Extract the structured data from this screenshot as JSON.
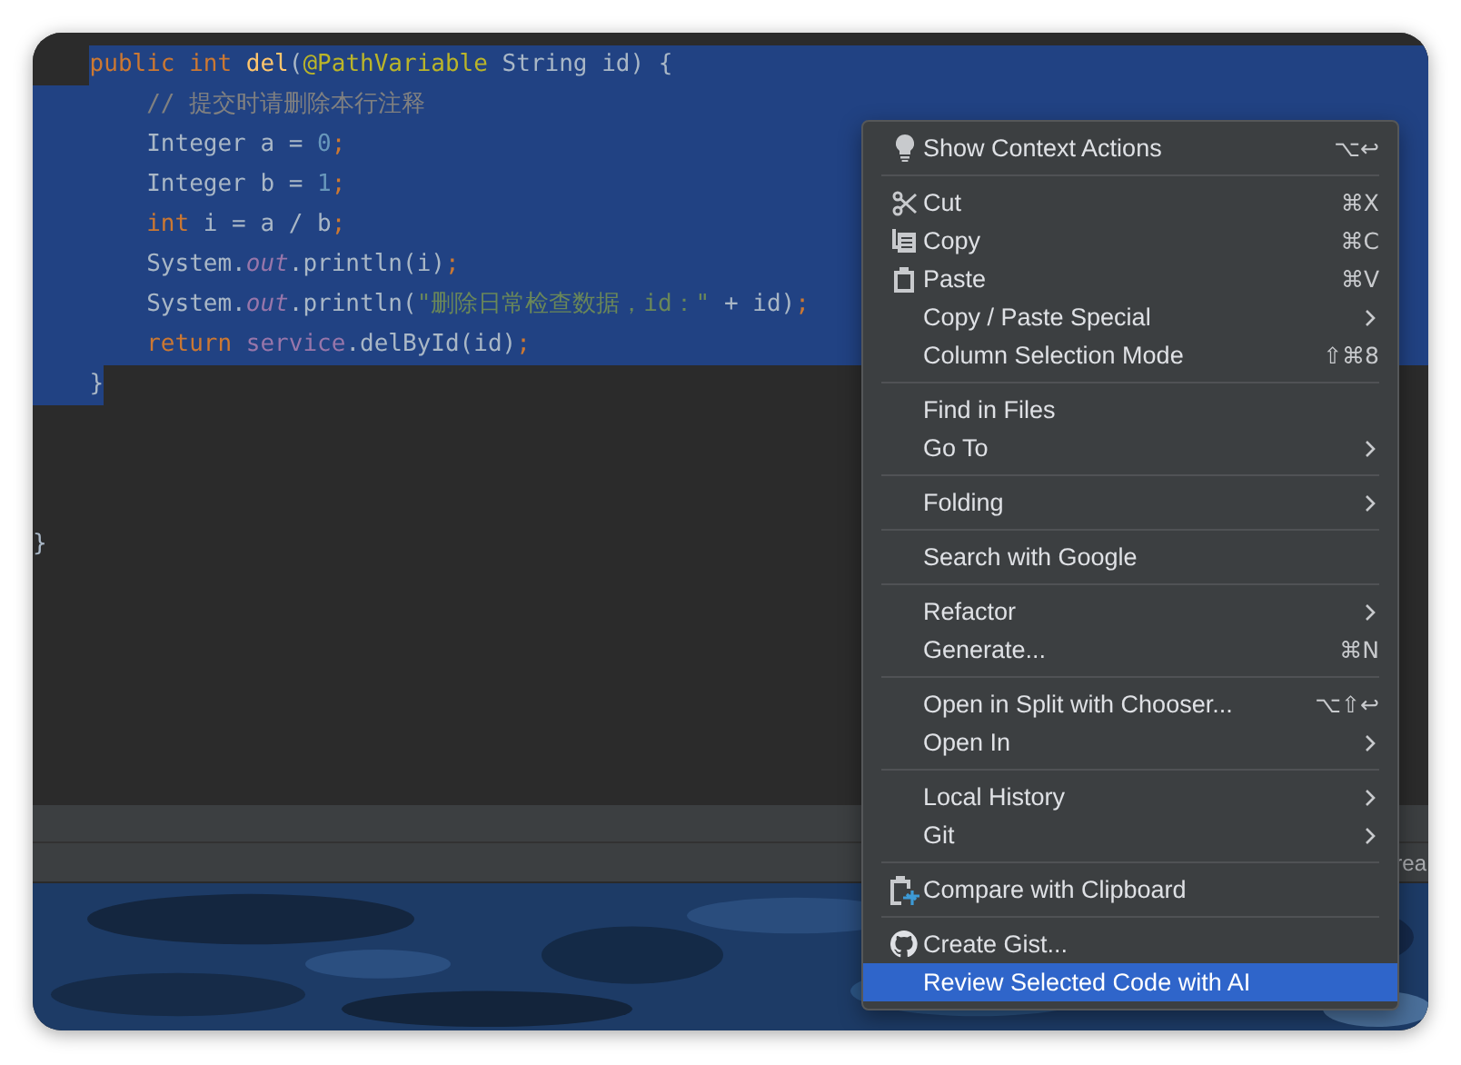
{
  "editor": {
    "code_lines": [
      {
        "kind": "signature",
        "selected": true,
        "tokens": [
          {
            "kind": "keyword",
            "text": "public "
          },
          {
            "kind": "keyword",
            "text": "int "
          },
          {
            "kind": "method",
            "text": "del"
          },
          {
            "kind": "plain",
            "text": "("
          },
          {
            "kind": "annotation",
            "text": "@PathVariable"
          },
          {
            "kind": "plain",
            "text": " String id) {"
          }
        ]
      },
      {
        "kind": "statement",
        "selected": true,
        "tokens": [
          {
            "kind": "comment",
            "text": "// 提交时请删除本行注释"
          }
        ]
      },
      {
        "kind": "statement",
        "selected": true,
        "tokens": [
          {
            "kind": "plain",
            "text": "Integer a = "
          },
          {
            "kind": "number",
            "text": "0"
          },
          {
            "kind": "punct",
            "text": ";"
          }
        ]
      },
      {
        "kind": "statement",
        "selected": true,
        "tokens": [
          {
            "kind": "plain",
            "text": "Integer b = "
          },
          {
            "kind": "number",
            "text": "1"
          },
          {
            "kind": "punct",
            "text": ";"
          }
        ]
      },
      {
        "kind": "statement",
        "selected": true,
        "tokens": [
          {
            "kind": "keyword",
            "text": "int"
          },
          {
            "kind": "plain",
            "text": " i = a / b"
          },
          {
            "kind": "punct",
            "text": ";"
          }
        ]
      },
      {
        "kind": "statement",
        "selected": true,
        "tokens": [
          {
            "kind": "plain",
            "text": "System."
          },
          {
            "kind": "static",
            "text": "out"
          },
          {
            "kind": "plain",
            "text": ".println(i)"
          },
          {
            "kind": "punct",
            "text": ";"
          }
        ]
      },
      {
        "kind": "statement",
        "selected": true,
        "tokens": [
          {
            "kind": "plain",
            "text": "System."
          },
          {
            "kind": "static",
            "text": "out"
          },
          {
            "kind": "plain",
            "text": ".println("
          },
          {
            "kind": "string",
            "text": "\"删除日常检查数据，id：\""
          },
          {
            "kind": "plain",
            "text": " + id)"
          },
          {
            "kind": "punct",
            "text": ";"
          }
        ]
      },
      {
        "kind": "statement",
        "selected": true,
        "tokens": [
          {
            "kind": "keyword",
            "text": "return "
          },
          {
            "kind": "field",
            "text": "service"
          },
          {
            "kind": "plain",
            "text": ".delById(id)"
          },
          {
            "kind": "punct",
            "text": ";"
          }
        ]
      },
      {
        "kind": "block-end",
        "selected": true,
        "tokens": [
          {
            "kind": "plain",
            "text": "}"
          }
        ]
      }
    ],
    "class_closing": "}"
  },
  "status_bar": {
    "text": "rea"
  },
  "context_menu": {
    "groups": [
      [
        {
          "kind": "bulb",
          "label": "Show Context Actions",
          "shortcut": "⌥↩",
          "submenu": false,
          "selected": false
        }
      ],
      [
        {
          "kind": "scissors",
          "label": "Cut",
          "shortcut": "⌘X",
          "submenu": false,
          "selected": false
        },
        {
          "kind": "copy",
          "label": "Copy",
          "shortcut": "⌘C",
          "submenu": false,
          "selected": false
        },
        {
          "kind": "clipboard",
          "label": "Paste",
          "shortcut": "⌘V",
          "submenu": false,
          "selected": false
        },
        {
          "kind": "plain",
          "label": "Copy / Paste Special",
          "submenu": true,
          "selected": false
        },
        {
          "kind": "plain",
          "label": "Column Selection Mode",
          "shortcut": "⇧⌘8",
          "submenu": false,
          "selected": false
        }
      ],
      [
        {
          "kind": "plain",
          "label": "Find in Files",
          "submenu": false,
          "selected": false
        },
        {
          "kind": "plain",
          "label": "Go To",
          "submenu": true,
          "selected": false
        }
      ],
      [
        {
          "kind": "plain",
          "label": "Folding",
          "submenu": true,
          "selected": false
        }
      ],
      [
        {
          "kind": "plain",
          "label": "Search with Google",
          "submenu": false,
          "selected": false
        }
      ],
      [
        {
          "kind": "plain",
          "label": "Refactor",
          "submenu": true,
          "selected": false
        },
        {
          "kind": "plain",
          "label": "Generate...",
          "shortcut": "⌘N",
          "submenu": false,
          "selected": false
        }
      ],
      [
        {
          "kind": "plain",
          "label": "Open in Split with Chooser...",
          "shortcut": "⌥⇧↩",
          "submenu": false,
          "selected": false
        },
        {
          "kind": "plain",
          "label": "Open In",
          "submenu": true,
          "selected": false
        }
      ],
      [
        {
          "kind": "plain",
          "label": "Local History",
          "submenu": true,
          "selected": false
        },
        {
          "kind": "plain",
          "label": "Git",
          "submenu": true,
          "selected": false
        }
      ],
      [
        {
          "kind": "compare",
          "label": "Compare with Clipboard",
          "submenu": false,
          "selected": false
        }
      ],
      [
        {
          "kind": "github",
          "label": "Create Gist...",
          "submenu": false,
          "selected": false
        },
        {
          "kind": "plain",
          "label": "Review Selected Code with AI",
          "submenu": false,
          "selected": true
        }
      ]
    ]
  }
}
